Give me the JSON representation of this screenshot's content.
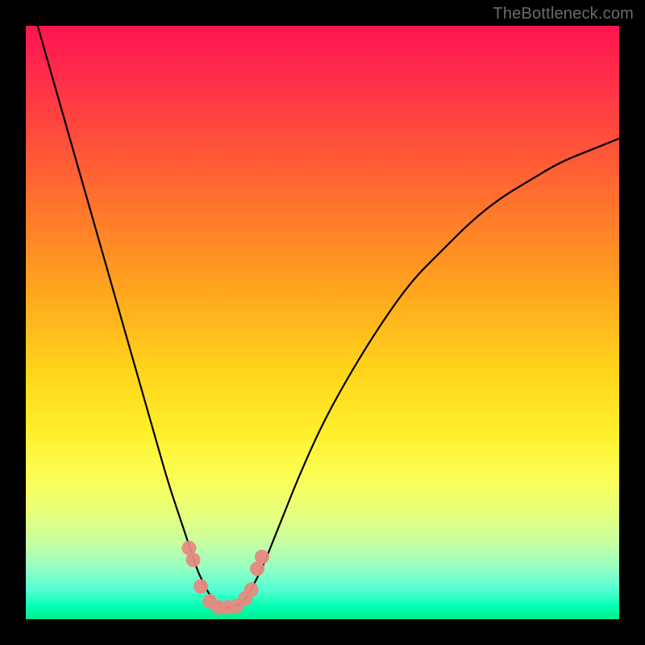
{
  "watermark": "TheBottleneck.com",
  "chart_data": {
    "type": "line",
    "title": "",
    "xlabel": "",
    "ylabel": "",
    "xlim": [
      0,
      100
    ],
    "ylim": [
      0,
      100
    ],
    "series": [
      {
        "name": "bottleneck-curve",
        "x": [
          2,
          4,
          6,
          8,
          10,
          12,
          14,
          16,
          18,
          20,
          22,
          24,
          26,
          28,
          29,
          30,
          31,
          32,
          33,
          34,
          35,
          36,
          37,
          38,
          40,
          42,
          44,
          46,
          50,
          55,
          60,
          65,
          70,
          75,
          80,
          85,
          90,
          95,
          100
        ],
        "values": [
          100,
          93,
          86,
          79,
          72,
          65,
          58,
          51,
          44,
          37,
          30,
          23,
          17,
          11,
          8,
          6,
          4,
          3,
          2,
          2,
          2,
          2.5,
          3.5,
          5,
          9,
          14,
          19,
          24,
          33,
          42,
          50,
          57,
          62,
          67,
          71,
          74,
          77,
          79,
          81
        ]
      }
    ],
    "markers": {
      "name": "highlight-points",
      "x": [
        27.5,
        28.2,
        29.5,
        31.0,
        32.5,
        34.0,
        35.5,
        37.0,
        38.0,
        39.0,
        39.8
      ],
      "values": [
        12.0,
        10.0,
        5.5,
        3.0,
        2.0,
        2.0,
        2.2,
        3.5,
        5.0,
        8.5,
        10.5
      ]
    },
    "gradient_stops": [
      {
        "pos": 0.0,
        "color": "#ff1450"
      },
      {
        "pos": 0.18,
        "color": "#ff4b3c"
      },
      {
        "pos": 0.44,
        "color": "#ffa31f"
      },
      {
        "pos": 0.68,
        "color": "#ffee2a"
      },
      {
        "pos": 0.87,
        "color": "#c8ffa0"
      },
      {
        "pos": 1.0,
        "color": "#02ee8f"
      }
    ]
  }
}
